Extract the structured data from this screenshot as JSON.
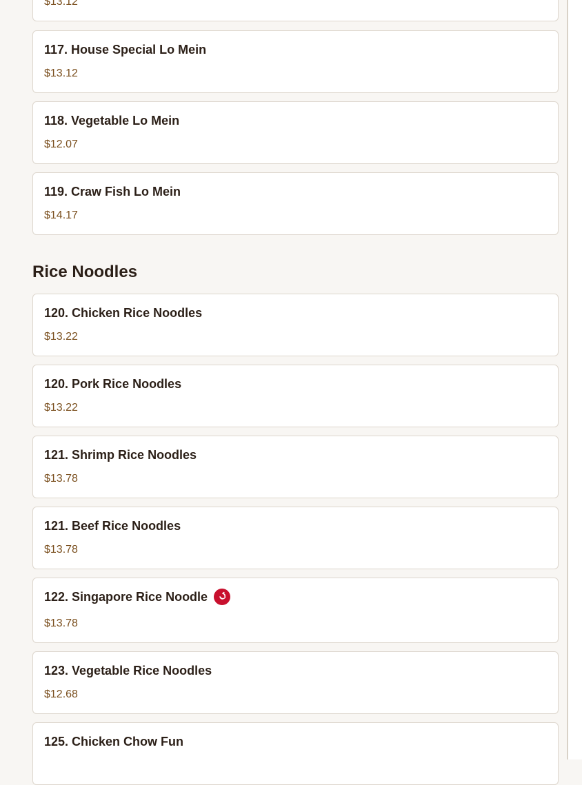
{
  "sections": [
    {
      "title": "",
      "items": [
        {
          "name": "",
          "price": "$13.12"
        },
        {
          "name": "117. House Special Lo Mein",
          "price": "$13.12"
        },
        {
          "name": "118. Vegetable Lo Mein",
          "price": "$12.07"
        },
        {
          "name": "119. Craw Fish Lo Mein",
          "price": "$14.17"
        }
      ]
    },
    {
      "title": "Rice Noodles",
      "items": [
        {
          "name": "120. Chicken Rice Noodles",
          "price": "$13.22"
        },
        {
          "name": "120. Pork Rice Noodles",
          "price": "$13.22"
        },
        {
          "name": "121. Shrimp Rice Noodles",
          "price": "$13.78"
        },
        {
          "name": "121. Beef Rice Noodles",
          "price": "$13.78"
        },
        {
          "name": "122. Singapore Rice Noodle",
          "price": "$13.78",
          "icon": "spicy-pepper-icon"
        },
        {
          "name": "123. Vegetable Rice Noodles",
          "price": "$12.68"
        },
        {
          "name": "125. Chicken Chow Fun",
          "price": ""
        }
      ]
    }
  ],
  "colors": {
    "page_background": "#f8f6f3",
    "card_border": "#ddd6cd",
    "price_text": "#7a4f1e",
    "spicy_badge": "#c8102e"
  }
}
